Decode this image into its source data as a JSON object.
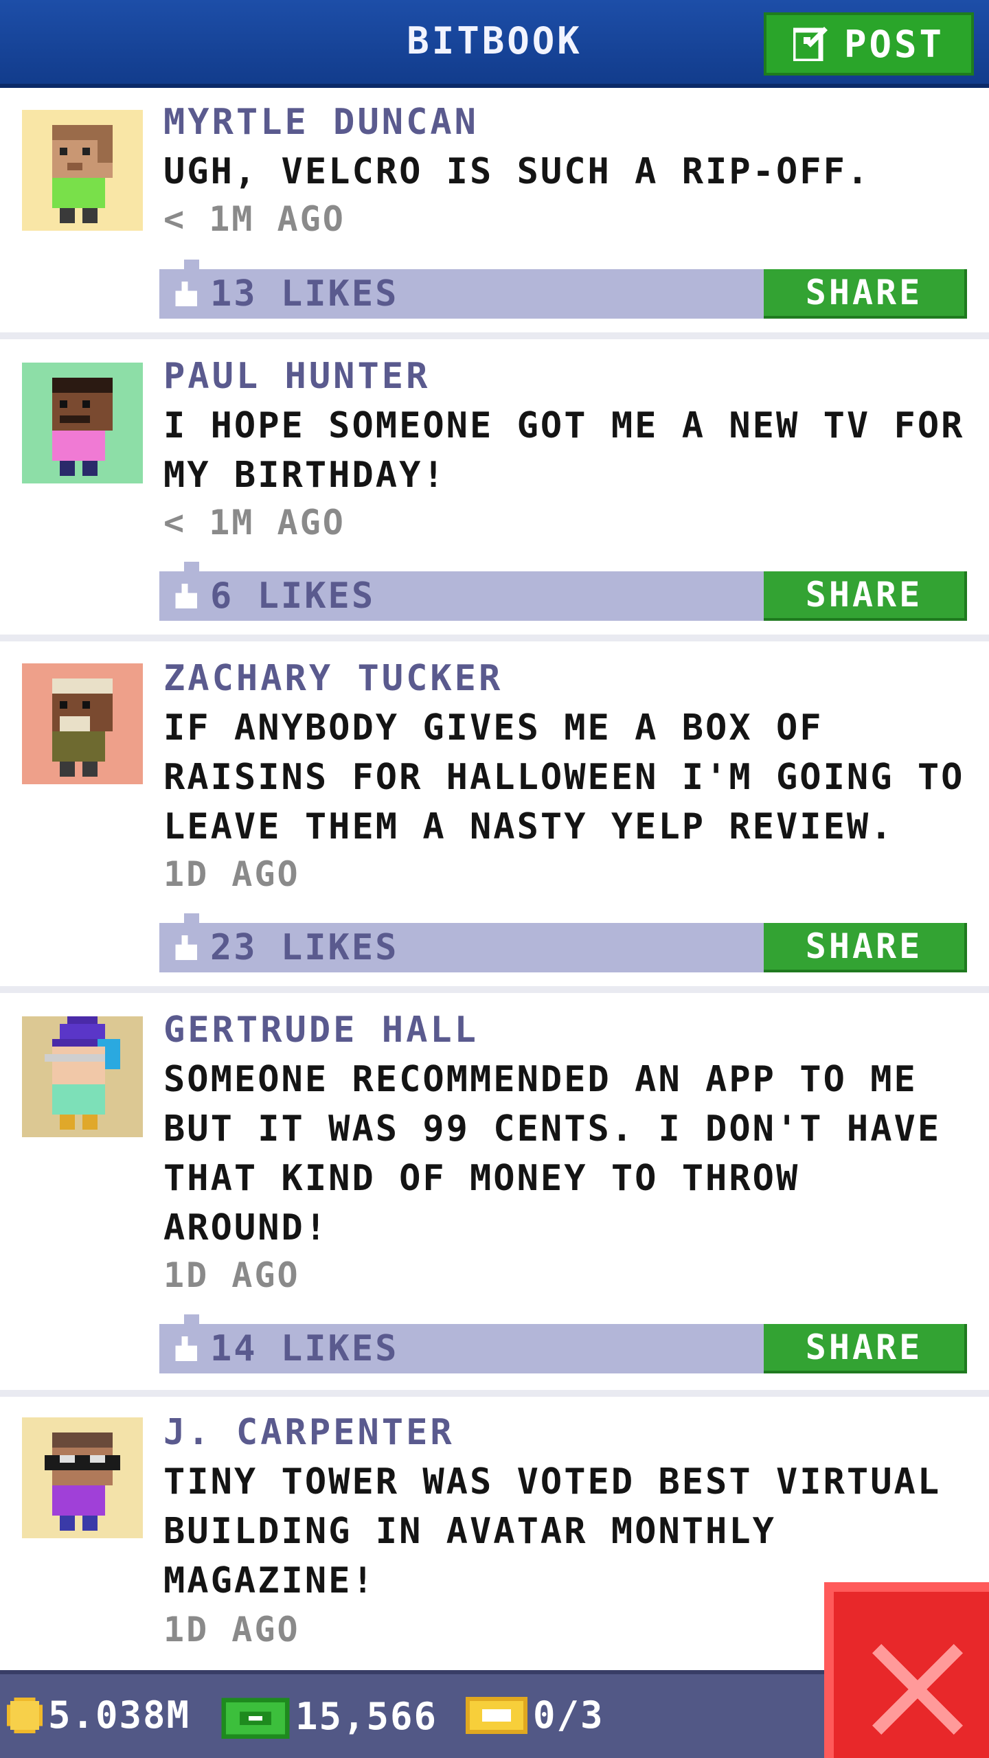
{
  "header": {
    "title": "BITBOOK",
    "post_label": "POST"
  },
  "posts": [
    {
      "author": "MYRTLE DUNCAN",
      "message": "UGH, VELCRO IS SUCH A RIP-OFF.",
      "time": "< 1M AGO",
      "likes": "13 LIKES",
      "share_label": "SHARE",
      "avatar_bg": "#f9e6a6"
    },
    {
      "author": "PAUL HUNTER",
      "message": "I HOPE SOMEONE GOT ME A NEW TV FOR MY BIRTHDAY!",
      "time": "< 1M AGO",
      "likes": "6 LIKES",
      "share_label": "SHARE",
      "avatar_bg": "#8ddea7"
    },
    {
      "author": "ZACHARY TUCKER",
      "message": "IF ANYBODY GIVES ME A BOX OF RAISINS FOR HALLOWEEN I'M GOING TO LEAVE THEM A NASTY YELP REVIEW.",
      "time": "1D AGO",
      "likes": "23 LIKES",
      "share_label": "SHARE",
      "avatar_bg": "#eea08a"
    },
    {
      "author": "GERTRUDE HALL",
      "message": "SOMEONE RECOMMENDED AN APP TO ME BUT IT WAS 99 CENTS. I DON'T HAVE THAT KIND OF MONEY TO THROW AROUND!",
      "time": "1D AGO",
      "likes": "14 LIKES",
      "share_label": "SHARE",
      "avatar_bg": "#dcc893"
    },
    {
      "author": "J. CARPENTER",
      "message": "TINY TOWER WAS VOTED BEST VIRTUAL BUILDING IN AVATAR MONTHLY MAGAZINE!",
      "time": "1D AGO",
      "likes": "",
      "share_label": "",
      "avatar_bg": "#f3e2a9"
    }
  ],
  "footer": {
    "coins": "5.038M",
    "bux": "15,566",
    "tickets": "0/3"
  },
  "colors": {
    "header_blue": "#1d4ea8",
    "share_green": "#33a333",
    "like_bar": "#b3b6d8",
    "close_red": "#e8282a"
  }
}
